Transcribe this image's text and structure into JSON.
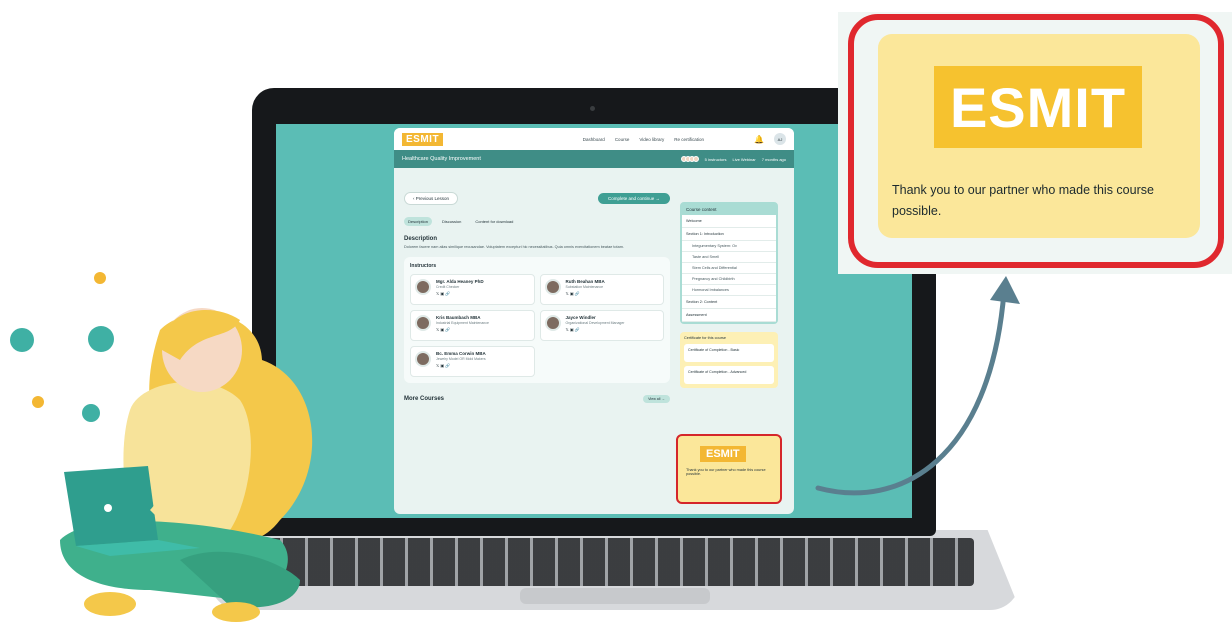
{
  "app": {
    "logo": "ESMIT",
    "nav": [
      "Dashboard",
      "Course",
      "Video library",
      "Re certification"
    ],
    "avatar": "AJ",
    "course_title": "Healthcare Quality Improvement",
    "instructors_count": "5 instructors",
    "live_webinar": "Live Webinar",
    "time_ago": "7 months ago",
    "previous_lesson": "Previous Lesson",
    "complete_continue": "Complete and continue",
    "tabs": [
      "Description",
      "Discussion",
      "Content for download"
    ],
    "description_title": "Description",
    "description_text": "Dolorem facere nam alias similique recusandae. Voluptatem excepturi hic necessitatibus. Quia omnis exercitationem beatae totam.",
    "instructors_title": "Instructors",
    "instructors": [
      {
        "name": "Mgr. Alda Heaney PhD",
        "role": "Credit Checker"
      },
      {
        "name": "Ruth Beahan MBA",
        "role": "Substation Maintenance"
      },
      {
        "name": "Kris Baumbach MBA",
        "role": "Industrial Equipment Maintenance"
      },
      {
        "name": "Jayce Windler",
        "role": "Organizational Development Manager"
      },
      {
        "name": "Bc. Emma Corwin MBA",
        "role": "Jewelry Model OR Mold Makers"
      }
    ],
    "more_courses": "More Courses",
    "view_all": "View all",
    "course_content_title": "Course content",
    "content_items": [
      {
        "label": "Welcome",
        "sub": false
      },
      {
        "label": "Section 1: Introduction",
        "sub": false
      },
      {
        "label": "Integumentary System: Ov",
        "sub": true
      },
      {
        "label": "Taste and Smell",
        "sub": true
      },
      {
        "label": "Stem Cells and Differential",
        "sub": true
      },
      {
        "label": "Pregnancy and Childbirth",
        "sub": true
      },
      {
        "label": "Hormonal Imbalances",
        "sub": true
      },
      {
        "label": "Section 2: Content",
        "sub": false
      },
      {
        "label": "Assessment",
        "sub": false
      }
    ],
    "certificate_title": "Certificate for this course",
    "certificates": [
      "Certificate of Completion - Basic",
      "Certificate of Completion - Advanced"
    ],
    "sponsor_text": "Thank you to our partner who made this course possible."
  },
  "callout": {
    "logo": "ESMIT",
    "text": "Thank you to our partner who made this course possible."
  },
  "colors": {
    "teal": "#3f8d86",
    "screen": "#5bbdb5",
    "sponsor_bg": "#fbe79a",
    "logo_yellow": "#f6c22f",
    "highlight_red": "#e0282e",
    "arrow": "#5a7f8f"
  }
}
